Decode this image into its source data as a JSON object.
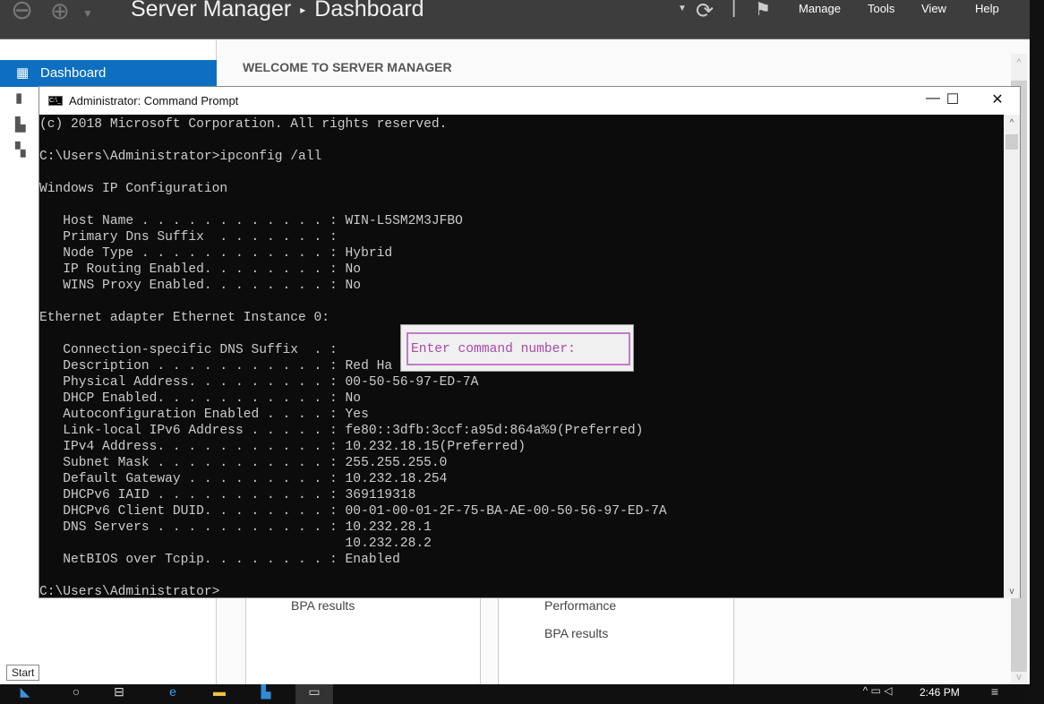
{
  "server_manager": {
    "title": "Server Manager",
    "breadcrumb": "Dashboard",
    "sep": "▸",
    "menu": [
      "Manage",
      "Tools",
      "View",
      "Help"
    ],
    "sidebar": {
      "selected": "Dashboard"
    },
    "welcome": "WELCOME TO SERVER MANAGER",
    "tiles": [
      {
        "items": [
          "BPA results"
        ]
      },
      {
        "items": [
          "Performance",
          "BPA results"
        ]
      }
    ]
  },
  "cmd": {
    "title": "Administrator: Command Prompt",
    "lines": [
      "(c) 2018 Microsoft Corporation. All rights reserved.",
      "",
      "C:\\Users\\Administrator>ipconfig /all",
      "",
      "Windows IP Configuration",
      "",
      "   Host Name . . . . . . . . . . . . : WIN-L5SM2M3JFBO",
      "   Primary Dns Suffix  . . . . . . . :",
      "   Node Type . . . . . . . . . . . . : Hybrid",
      "   IP Routing Enabled. . . . . . . . : No",
      "   WINS Proxy Enabled. . . . . . . . : No",
      "",
      "Ethernet adapter Ethernet Instance 0:",
      "",
      "   Connection-specific DNS Suffix  . :",
      "   Description . . . . . . . . . . . : Red Ha",
      "   Physical Address. . . . . . . . . : 00-50-56-97-ED-7A",
      "   DHCP Enabled. . . . . . . . . . . : No",
      "   Autoconfiguration Enabled . . . . : Yes",
      "   Link-local IPv6 Address . . . . . : fe80::3dfb:3ccf:a95d:864a%9(Preferred)",
      "   IPv4 Address. . . . . . . . . . . : 10.232.18.15(Preferred)",
      "   Subnet Mask . . . . . . . . . . . : 255.255.255.0",
      "   Default Gateway . . . . . . . . . : 10.232.18.254",
      "   DHCPv6 IAID . . . . . . . . . . . : 369119318",
      "   DHCPv6 Client DUID. . . . . . . . : 00-01-00-01-2F-75-BA-AE-00-50-56-97-ED-7A",
      "   DNS Servers . . . . . . . . . . . : 10.232.28.1",
      "                                       10.232.28.2",
      "   NetBIOS over Tcpip. . . . . . . . : Enabled",
      "",
      "C:\\Users\\Administrator>"
    ]
  },
  "popup": {
    "prompt": "Enter command number:"
  },
  "start_tooltip": "Start",
  "taskbar": {
    "clock": "2:46 PM"
  }
}
